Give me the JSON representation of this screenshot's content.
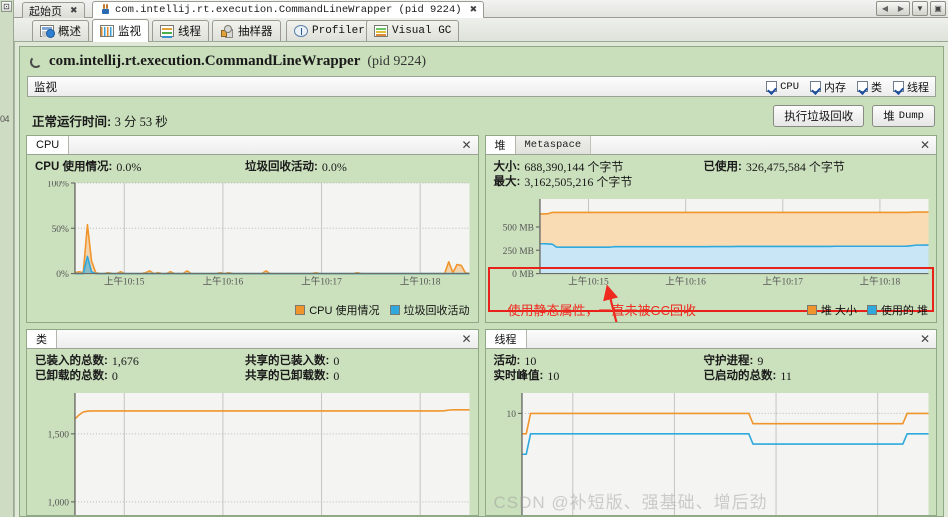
{
  "window": {
    "tabs": [
      {
        "label": "起始页",
        "active": false,
        "icon": "none",
        "closable": true
      },
      {
        "label": "com.intellij.rt.execution.CommandLineWrapper  (pid 9224)",
        "active": true,
        "icon": "java-icon",
        "closable": true
      }
    ],
    "controls": [
      "scroll-left-icon",
      "scroll-right-icon",
      "dropdown-icon",
      "maximize-icon"
    ],
    "gutter_button": "⊡",
    "gutter_text": "04"
  },
  "view_tabs": [
    {
      "label": "概述",
      "icon": "overview-icon",
      "active": false,
      "mono": false
    },
    {
      "label": "监视",
      "icon": "monitor-icon",
      "active": true,
      "mono": false
    },
    {
      "label": "线程",
      "icon": "threads-icon",
      "active": false,
      "mono": false
    },
    {
      "label": "抽样器",
      "icon": "sampler-icon",
      "active": false,
      "mono": false
    },
    {
      "label": "Profiler",
      "icon": "profiler-icon",
      "active": false,
      "mono": true
    },
    {
      "label": "Visual GC",
      "icon": "visual-gc-icon",
      "active": false,
      "mono": true
    }
  ],
  "header": {
    "app_name": "com.intellij.rt.execution.CommandLineWrapper",
    "pid_text": "(pid 9224)",
    "spinner_icon": "loading-spinner-icon"
  },
  "monitor_bar": {
    "title": "监视",
    "checkboxes": [
      {
        "label": "CPU",
        "checked": true,
        "mono": true
      },
      {
        "label": "内存",
        "checked": true,
        "mono": false
      },
      {
        "label": "类",
        "checked": true,
        "mono": false
      },
      {
        "label": "线程",
        "checked": true,
        "mono": false
      }
    ]
  },
  "uptime": {
    "label": "正常运行时间:",
    "value": "3 分 53 秒"
  },
  "buttons": {
    "gc": "执行垃圾回收",
    "heap_dump_prefix": "堆",
    "heap_dump_suffix": "Dump"
  },
  "panels": {
    "cpu": {
      "tab": "CPU",
      "close_icon": "close-icon",
      "stat_cpu_label": "CPU 使用情况:",
      "stat_cpu_value": "0.0%",
      "stat_gc_label": "垃圾回收活动:",
      "stat_gc_value": "0.0%",
      "legend": [
        {
          "label": "CPU 使用情况",
          "color": "#f0952c"
        },
        {
          "label": "垃圾回收活动",
          "color": "#2ea8dd"
        }
      ]
    },
    "heap": {
      "tab_active": "堆",
      "tab_inactive": "Metaspace",
      "close_icon": "close-icon",
      "size_label": "大小:",
      "size_value": "688,390,144 个字节",
      "used_label": "已使用:",
      "used_value": "326,475,584 个字节",
      "max_label": "最大:",
      "max_value": "3,162,505,216 个字节",
      "legend": [
        {
          "label": "堆 大小",
          "color": "#f0952c"
        },
        {
          "label": "使用的 堆",
          "color": "#2ea8dd"
        }
      ],
      "annotation_text": "使用静态属性，一直未被GC回收",
      "annotation_color": "#ef2a20"
    },
    "classes": {
      "tab": "类",
      "close_icon": "close-icon",
      "loaded_label": "已装入的总数:",
      "loaded_value": "1,676",
      "shared_loaded_label": "共享的已装入数:",
      "shared_loaded_value": "0",
      "unloaded_label": "已卸载的总数:",
      "unloaded_value": "0",
      "shared_unloaded_label": "共享的已卸载数:",
      "shared_unloaded_value": "0"
    },
    "threads": {
      "tab": "线程",
      "close_icon": "close-icon",
      "live_label": "活动:",
      "live_value": "10",
      "daemon_label": "守护进程:",
      "daemon_value": "9",
      "peak_label": "实时峰值:",
      "peak_value": "10",
      "started_label": "已启动的总数:",
      "started_value": "11"
    }
  },
  "watermark": "CSDN @补短版、强基础、增后劲",
  "chart_data": [
    {
      "id": "cpu-chart",
      "type": "area",
      "title": "CPU",
      "xlabel": "",
      "ylabel": "",
      "ylim": [
        0,
        100
      ],
      "yticks": [
        0,
        50,
        100
      ],
      "ytick_labels": [
        "0%",
        "50%",
        "100%"
      ],
      "xtick_labels": [
        "上午10:15",
        "上午10:16",
        "上午10:17",
        "上午10:18"
      ],
      "grid": true,
      "legend_position": "bottom-right",
      "series": [
        {
          "name": "CPU 使用情况",
          "color": "#f0952c",
          "values": [
            1,
            2,
            1,
            54,
            14,
            1,
            0,
            0,
            1,
            0,
            0,
            2,
            0,
            0,
            0,
            0,
            0,
            1,
            3,
            0,
            1,
            0,
            0,
            2,
            0,
            0,
            0,
            3,
            0,
            0,
            0,
            0,
            0,
            0,
            0,
            1,
            0,
            1,
            0,
            0,
            0,
            0,
            0,
            0,
            0,
            0,
            3,
            0,
            0,
            0,
            0,
            0,
            0,
            0,
            0,
            0,
            0,
            0,
            1,
            0,
            0,
            0,
            0,
            0,
            0,
            0,
            0,
            0,
            1,
            0,
            0,
            0,
            0,
            0,
            0,
            0,
            0,
            0,
            0,
            0,
            0,
            0,
            0,
            0,
            0,
            0,
            0,
            0,
            0,
            0,
            13,
            1,
            10,
            9,
            1,
            0
          ]
        },
        {
          "name": "垃圾回收活动",
          "color": "#2ea8dd",
          "values": [
            0,
            0,
            0,
            19,
            2,
            0,
            0,
            0,
            0,
            0,
            0,
            0,
            0,
            0,
            0,
            0,
            0,
            0,
            0,
            0,
            0,
            0,
            0,
            0,
            0,
            0,
            0,
            0,
            0,
            0,
            0,
            0,
            0,
            0,
            0,
            0,
            0,
            0,
            0,
            0,
            0,
            0,
            0,
            0,
            0,
            0,
            0,
            0,
            0,
            0,
            0,
            0,
            0,
            0,
            0,
            0,
            0,
            0,
            0,
            0,
            0,
            0,
            0,
            0,
            0,
            0,
            0,
            0,
            0,
            0,
            0,
            0,
            0,
            0,
            0,
            0,
            0,
            0,
            0,
            0,
            0,
            0,
            0,
            0,
            0,
            0,
            0,
            0,
            0,
            0,
            0,
            0,
            0,
            0,
            0,
            0
          ]
        }
      ]
    },
    {
      "id": "heap-chart",
      "type": "area",
      "title": "堆",
      "xlabel": "",
      "ylabel": "MB",
      "ylim": [
        0,
        800
      ],
      "yticks": [
        0,
        250,
        500
      ],
      "ytick_labels": [
        "0 MB",
        "250 MB",
        "500 MB"
      ],
      "xtick_labels": [
        "上午10:15",
        "上午10:16",
        "上午10:17",
        "上午10:18"
      ],
      "grid": true,
      "legend_position": "bottom-right",
      "series": [
        {
          "name": "堆 大小",
          "color": "#f0952c",
          "fill": "#fadcb4",
          "values": [
            640,
            640,
            642,
            656,
            656,
            656,
            656,
            656,
            656,
            656,
            656,
            656,
            656,
            656,
            656,
            656,
            656,
            656,
            656,
            656,
            656,
            656,
            656,
            656,
            656,
            656,
            656,
            656,
            656,
            656,
            656,
            656,
            656,
            656,
            656,
            656,
            656,
            656,
            656,
            656,
            656,
            656,
            656,
            656,
            656,
            656,
            656,
            656,
            656,
            656,
            656,
            656,
            656,
            656,
            656,
            656,
            656,
            656,
            656,
            656,
            656,
            656,
            656,
            656,
            656,
            656,
            656,
            656,
            656,
            656,
            656,
            656,
            656,
            656,
            656,
            656,
            656,
            656,
            656,
            656,
            656,
            656,
            656,
            656,
            656,
            656,
            656,
            656,
            656,
            656,
            656,
            658,
            660,
            660,
            660,
            660
          ]
        },
        {
          "name": "使用的 堆",
          "color": "#2ea8dd",
          "fill": "#c9e6f7",
          "values": [
            320,
            320,
            318,
            316,
            285,
            283,
            283,
            283,
            283,
            283,
            283,
            283,
            283,
            283,
            283,
            283,
            283,
            283,
            288,
            288,
            288,
            288,
            288,
            288,
            288,
            288,
            288,
            288,
            288,
            288,
            288,
            288,
            288,
            288,
            288,
            288,
            288,
            288,
            288,
            288,
            288,
            288,
            290,
            290,
            290,
            290,
            290,
            290,
            291,
            291,
            291,
            291,
            291,
            291,
            291,
            291,
            291,
            291,
            291,
            291,
            291,
            291,
            291,
            291,
            291,
            291,
            291,
            291,
            291,
            291,
            291,
            291,
            293,
            293,
            293,
            293,
            293,
            293,
            293,
            293,
            293,
            293,
            293,
            293,
            293,
            293,
            293,
            293,
            293,
            293,
            295,
            300,
            305,
            305,
            306,
            306
          ]
        }
      ]
    },
    {
      "id": "classes-chart",
      "type": "line",
      "title": "类",
      "xlabel": "",
      "ylabel": "",
      "ylim": [
        900,
        1800
      ],
      "yticks": [
        1000,
        1500
      ],
      "ytick_labels": [
        "1,000",
        "1,500"
      ],
      "xtick_labels": [],
      "grid": true,
      "legend_position": "none",
      "series": [
        {
          "name": "已装入的总数",
          "color": "#f0952c",
          "values": [
            1610,
            1640,
            1660,
            1666,
            1668,
            1668,
            1668,
            1668,
            1668,
            1668,
            1668,
            1668,
            1668,
            1668,
            1668,
            1668,
            1668,
            1668,
            1668,
            1668,
            1668,
            1668,
            1668,
            1668,
            1668,
            1668,
            1668,
            1668,
            1668,
            1668,
            1668,
            1668,
            1668,
            1668,
            1668,
            1668,
            1668,
            1668,
            1668,
            1668,
            1668,
            1668,
            1668,
            1668,
            1668,
            1668,
            1668,
            1668,
            1668,
            1668,
            1668,
            1668,
            1668,
            1668,
            1668,
            1668,
            1668,
            1668,
            1668,
            1668,
            1668,
            1668,
            1668,
            1668,
            1668,
            1668,
            1668,
            1668,
            1668,
            1668,
            1668,
            1668,
            1668,
            1668,
            1668,
            1668,
            1668,
            1668,
            1668,
            1668,
            1668,
            1668,
            1668,
            1668,
            1668,
            1668,
            1668,
            1668,
            1668,
            1670,
            1674,
            1676,
            1676,
            1676,
            1676,
            1676
          ]
        }
      ]
    },
    {
      "id": "threads-chart",
      "type": "line",
      "title": "线程",
      "xlabel": "",
      "ylabel": "",
      "ylim": [
        0,
        12
      ],
      "yticks": [
        10
      ],
      "ytick_labels": [
        "10"
      ],
      "xtick_labels": [],
      "grid": true,
      "legend_position": "none",
      "series": [
        {
          "name": "活动",
          "color": "#f0952c",
          "values": [
            8,
            8,
            10,
            10,
            10,
            10,
            10,
            10,
            10,
            10,
            10,
            10,
            10,
            10,
            10,
            10,
            10,
            10,
            10,
            10,
            10,
            10,
            10,
            10,
            10,
            10,
            10,
            10,
            10,
            10,
            10,
            10,
            10,
            10,
            10,
            10,
            10,
            10,
            10,
            10,
            10,
            10,
            10,
            10,
            10,
            10,
            10,
            10,
            10,
            10,
            10,
            10,
            10,
            10,
            9,
            9,
            9,
            9,
            9,
            9,
            9,
            9,
            9,
            9,
            9,
            9,
            9,
            9,
            9,
            9,
            9,
            9,
            9,
            9,
            9,
            9,
            9,
            9,
            9,
            9,
            9,
            9,
            9,
            9,
            9,
            9,
            9,
            9,
            9,
            9,
            10,
            10,
            10,
            10,
            10,
            10
          ]
        },
        {
          "name": "守护进程",
          "color": "#2ea8dd",
          "values": [
            6,
            6,
            8,
            8,
            8,
            8,
            8,
            8,
            8,
            8,
            8,
            8,
            8,
            8,
            8,
            8,
            8,
            8,
            8,
            8,
            8,
            8,
            8,
            8,
            8,
            8,
            8,
            8,
            8,
            8,
            8,
            8,
            8,
            8,
            8,
            8,
            8,
            8,
            8,
            8,
            8,
            8,
            8,
            8,
            8,
            8,
            8,
            8,
            8,
            8,
            8,
            8,
            8,
            8,
            7,
            7,
            7,
            7,
            7,
            7,
            7,
            7,
            7,
            7,
            7,
            7,
            7,
            7,
            7,
            7,
            7,
            7,
            7,
            7,
            7,
            7,
            7,
            7,
            7,
            7,
            7,
            7,
            7,
            7,
            7,
            7,
            7,
            7,
            7,
            7,
            8,
            8,
            8,
            8,
            8,
            8
          ]
        }
      ]
    }
  ]
}
